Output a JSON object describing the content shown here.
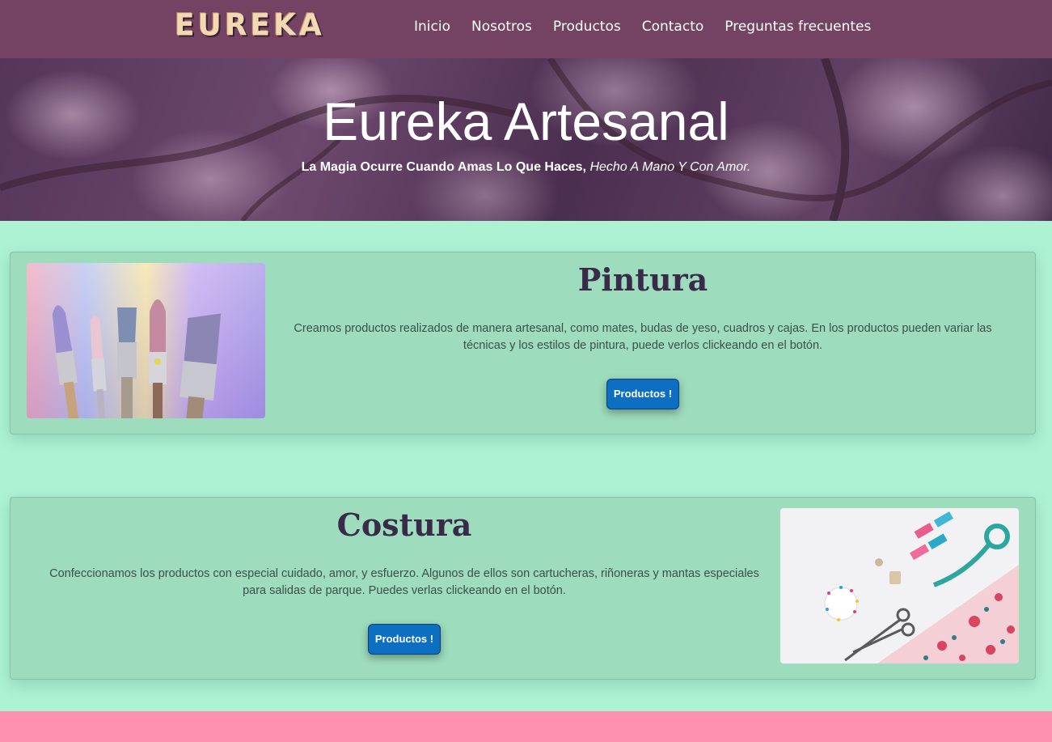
{
  "navbar": {
    "logo_text": "EUREKA",
    "links": [
      {
        "label": "Inicio"
      },
      {
        "label": "Nosotros"
      },
      {
        "label": "Productos"
      },
      {
        "label": "Contacto"
      },
      {
        "label": "Preguntas frecuentes"
      }
    ]
  },
  "hero": {
    "title": "Eureka Artesanal",
    "subtitle_bold": "La Magia Ocurre Cuando Amas Lo Que Haces,",
    "subtitle_italic": "Hecho A Mano Y Con Amor."
  },
  "cards": [
    {
      "title": "Pintura",
      "text": "Creamos productos realizados de manera artesanal, como mates, budas de yeso, cuadros y cajas. En los productos pueden variar las técnicas y los estilos de pintura, puede verlos clickeando en el botón.",
      "button_label": "Productos !",
      "image_icon": "paint-brushes-photo"
    },
    {
      "title": "Costura",
      "text": "Confeccionamos los productos con especial cuidado, amor, y esfuerzo. Algunos de ellos son cartucheras, riñoneras y mantas especiales para salidas de parque. Puedes verlas clickeando en el botón.",
      "button_label": "Productos !",
      "image_icon": "sewing-supplies-photo"
    }
  ],
  "colors": {
    "navbar": "#744263",
    "page_background": "#adf2d3",
    "card_background": "#9ddcbd",
    "button": "#0d6fc2",
    "footer": "#ff91b0"
  }
}
